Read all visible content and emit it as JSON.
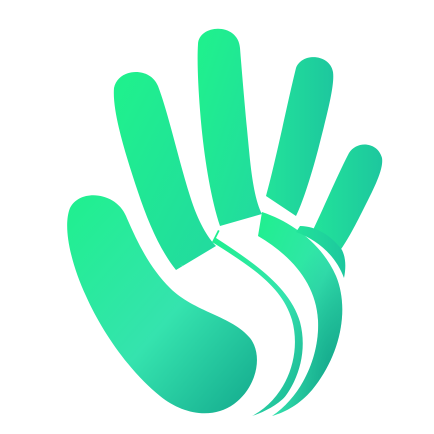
{
  "logo": {
    "icon": "hand-logo-icon",
    "colors": {
      "bright_green": "#1FF28C",
      "mint": "#3AE6B0",
      "teal": "#16B493",
      "dark_teal": "#0FA389",
      "background": "#FFFFFF"
    }
  }
}
